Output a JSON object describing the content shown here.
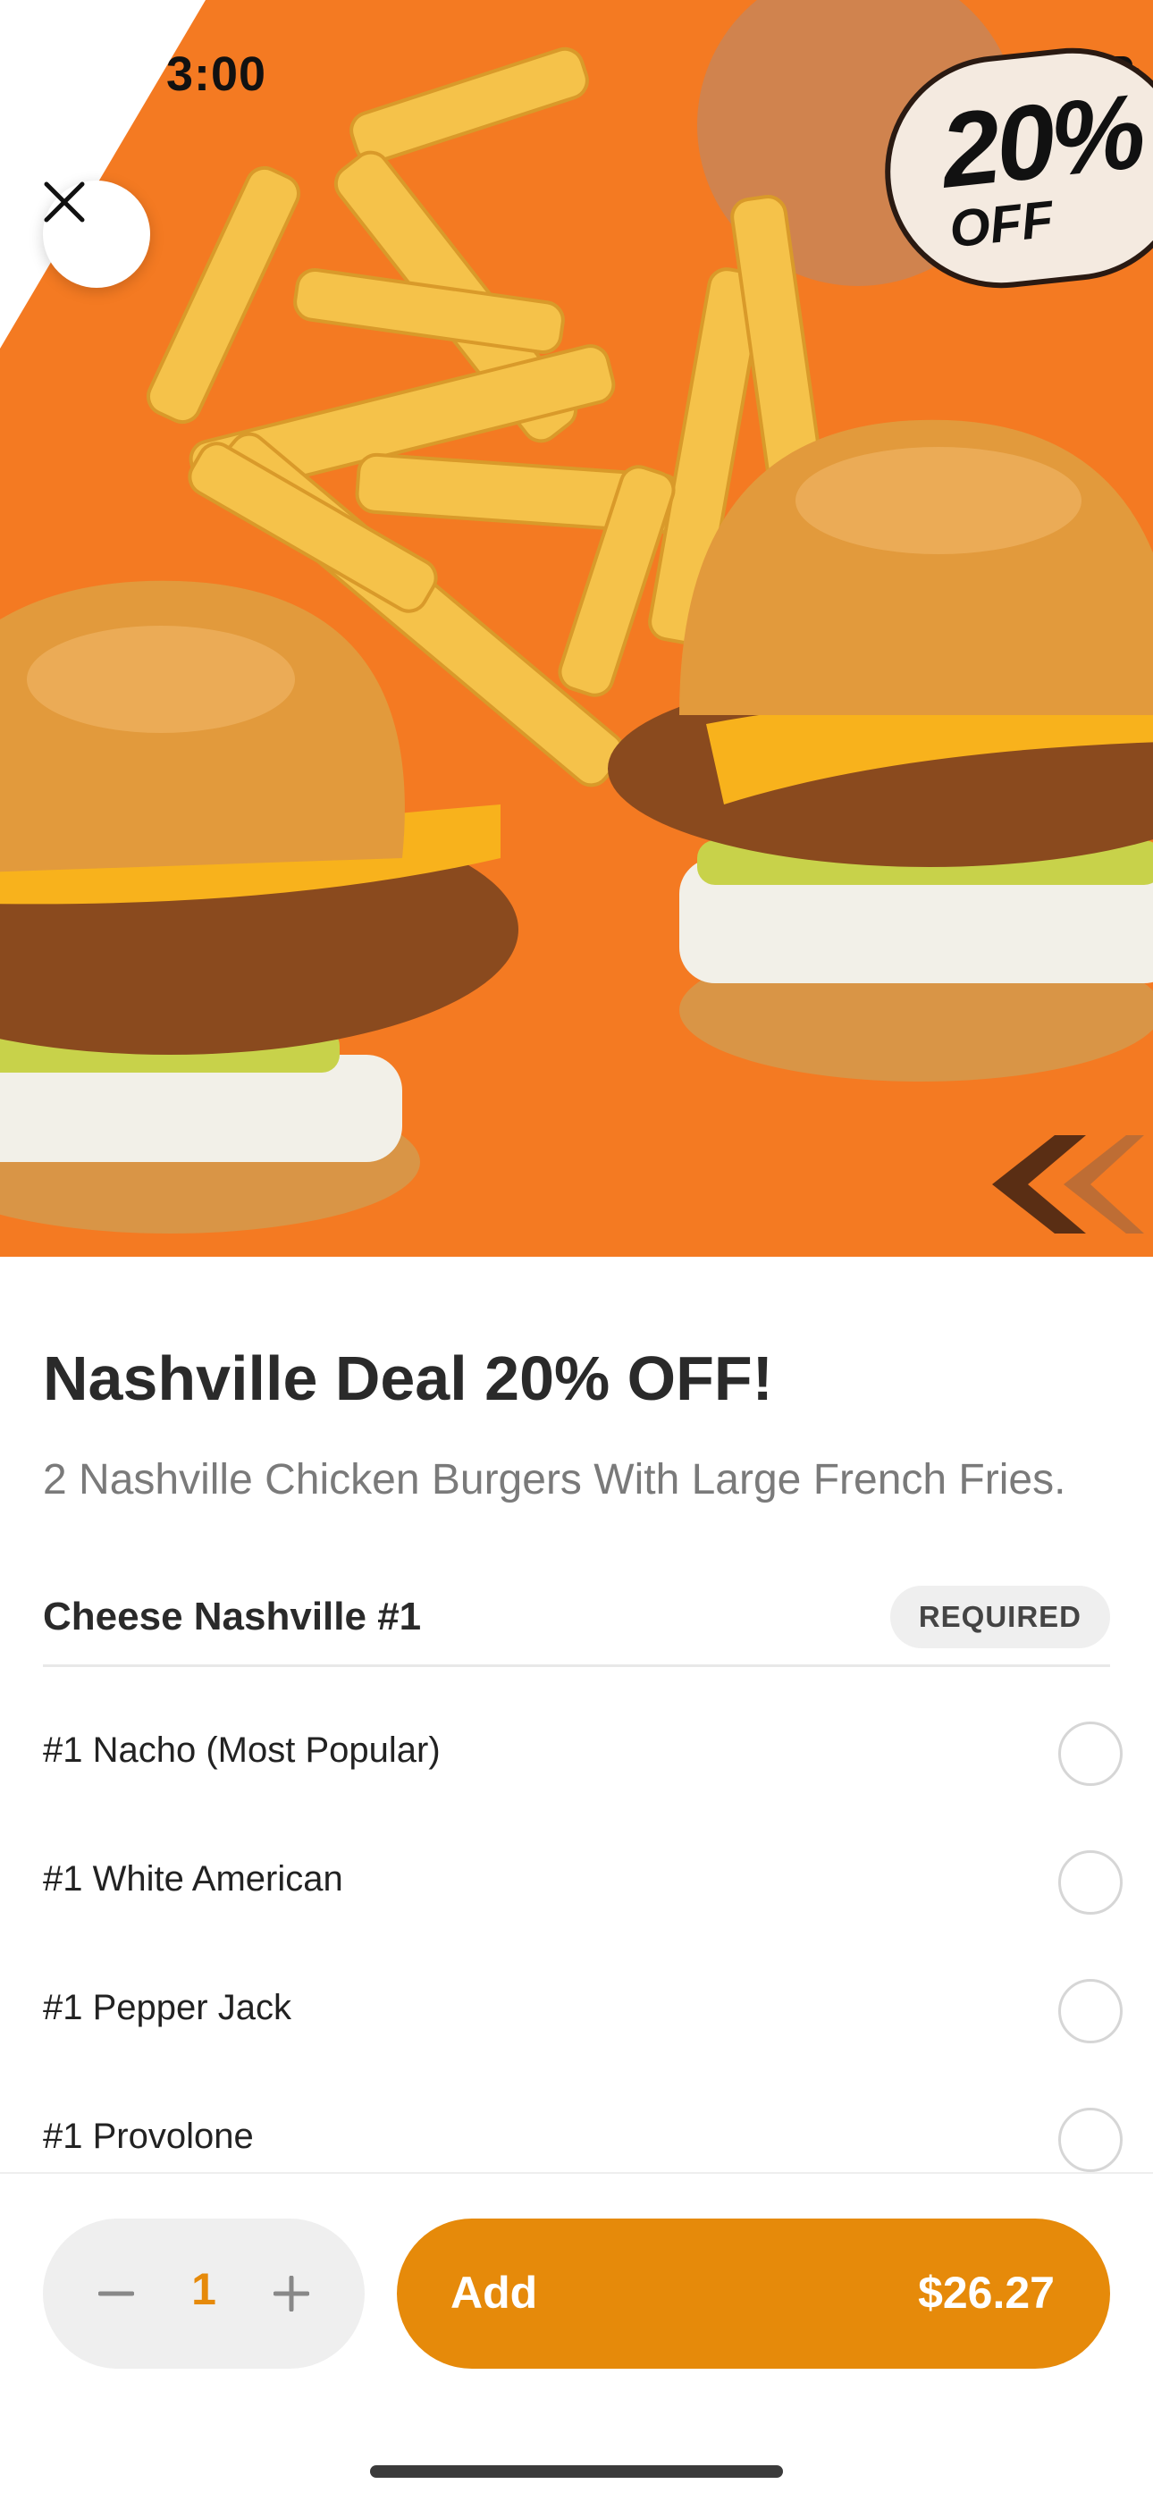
{
  "status_bar": {
    "time": "3:00"
  },
  "hero": {
    "promo_badge": {
      "percent": "20%",
      "off": "OFF"
    },
    "colors": {
      "background": "#F47A22",
      "bun": "#E29A3C",
      "fries": "#F5C24A",
      "chicken": "#8A4A1E",
      "cheese": "#F8B21C"
    }
  },
  "item": {
    "title": "Nashville Deal 20% OFF!",
    "description": "2 Nashville Chicken Burgers With Large French Fries."
  },
  "section": {
    "title": "Cheese Nashville #1",
    "required_label": "REQUIRED",
    "options": [
      {
        "label": "#1 Nacho (Most Popular)"
      },
      {
        "label": "#1 White American"
      },
      {
        "label": "#1 Pepper Jack"
      },
      {
        "label": "#1 Provolone"
      }
    ]
  },
  "footer": {
    "quantity": "1",
    "add_label": "Add",
    "price": "$26.27",
    "accent_color": "#E68A0A"
  },
  "icons": [
    "close-icon",
    "minus-icon",
    "plus-icon",
    "wifi-icon",
    "battery-icon",
    "signal-icon"
  ]
}
